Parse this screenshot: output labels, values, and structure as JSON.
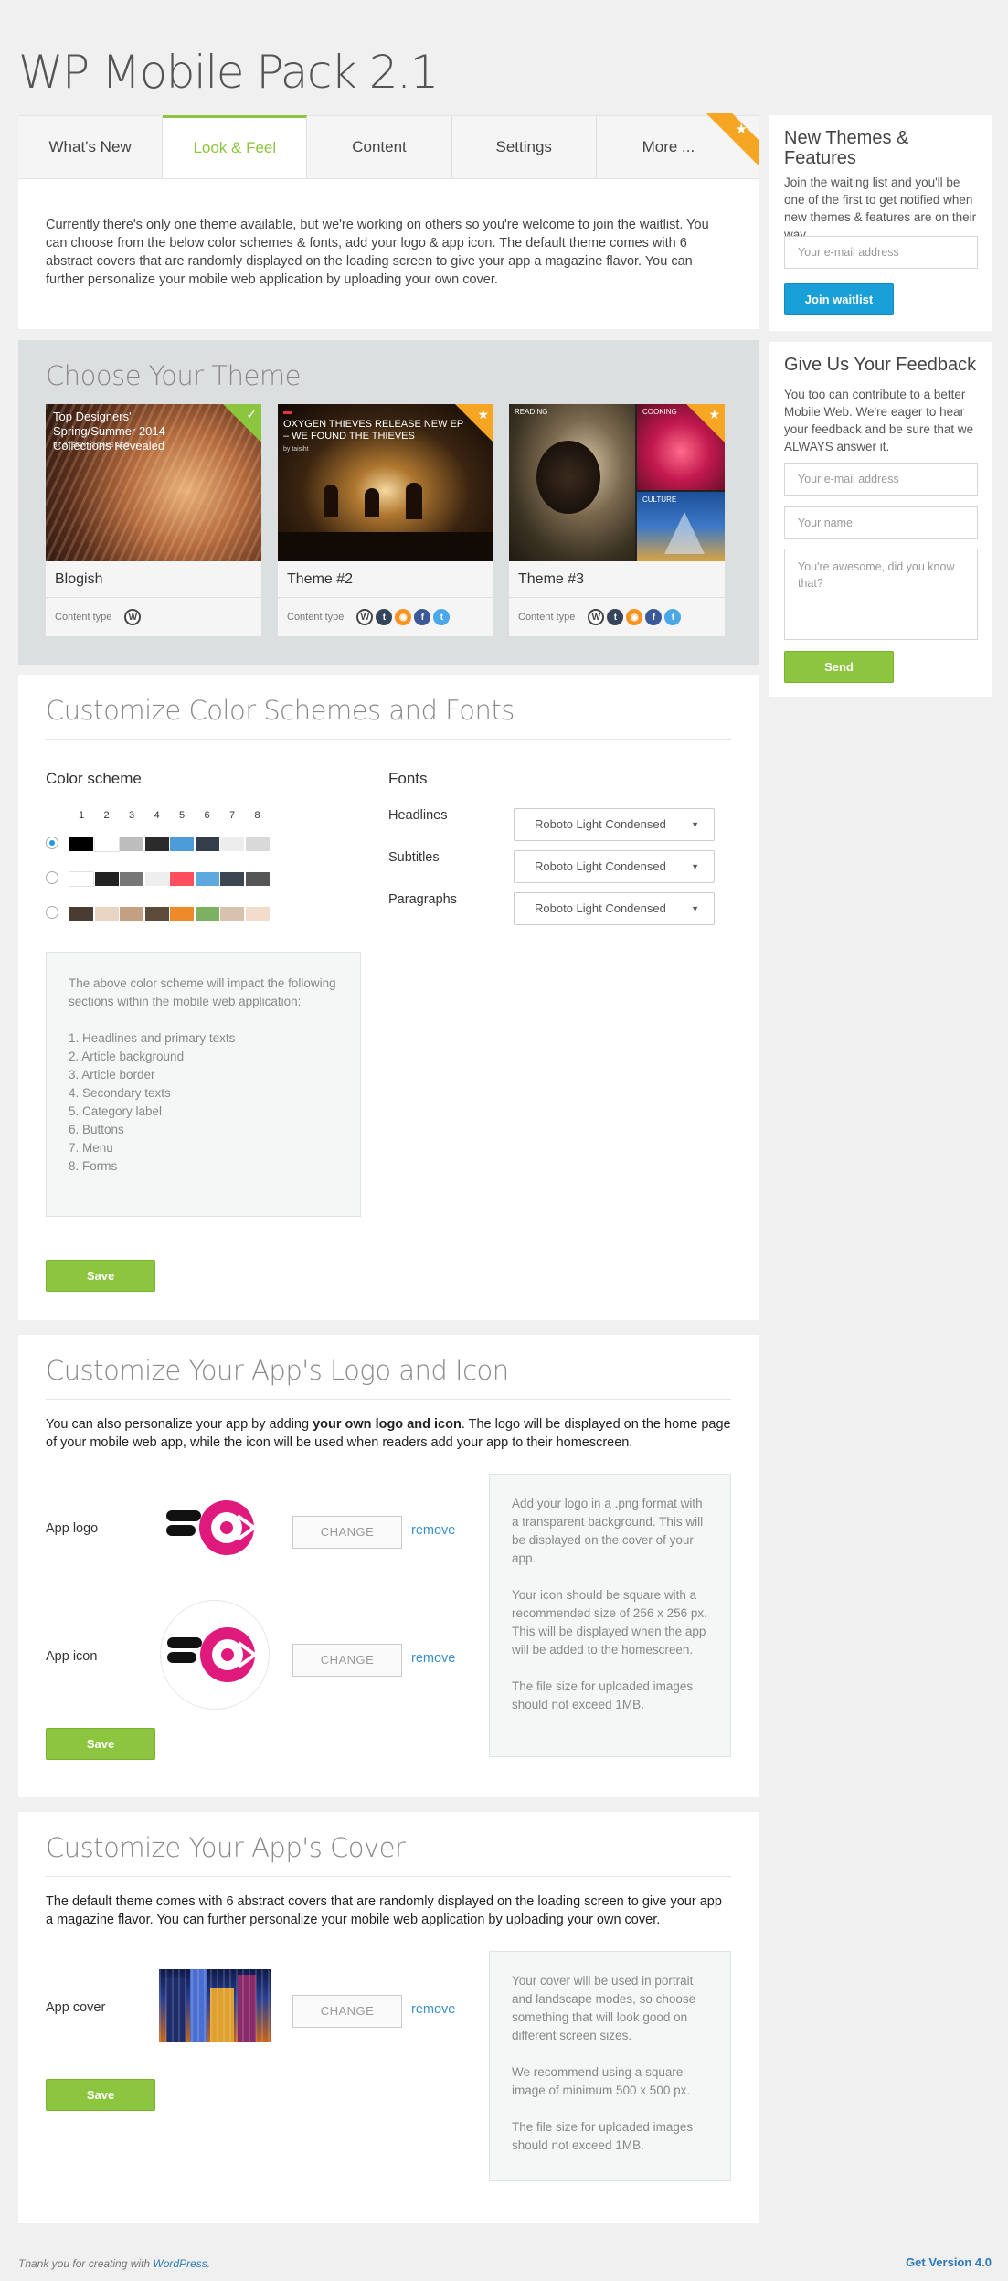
{
  "app_title": "WP Mobile Pack 2.1",
  "tabs": [
    {
      "label": "What's New"
    },
    {
      "label": "Look & Feel"
    },
    {
      "label": "Content"
    },
    {
      "label": "Settings"
    },
    {
      "label": "More ..."
    }
  ],
  "intro_text": "Currently there's only one theme available, but we're working on others so you're welcome to join the waitlist. You can choose from the below color schemes & fonts, add your logo & app icon. The default theme comes with 6 abstract covers that are randomly displayed on the loading screen to give your app a magazine flavor. You can further personalize your mobile web application by uploading your own cover.",
  "themes": {
    "title": "Choose Your Theme",
    "content_type_label": "Content type",
    "cards": [
      {
        "name": "Blogish",
        "caption": "Top Designers' Spring/Summer 2014 Collections Revealed",
        "meta": "BY STEFIN · 3 DAYS AGO",
        "icons": [
          "wordpress-icon"
        ]
      },
      {
        "name": "Theme #2",
        "caption": "OXYGEN THIEVES RELEASE NEW EP – WE FOUND THE THIEVES",
        "meta": "by taisiht",
        "icons": [
          "wordpress-icon",
          "tumblr-icon",
          "rss-icon",
          "facebook-icon",
          "twitter-icon"
        ]
      },
      {
        "name": "Theme #3",
        "tag1": "READING",
        "tag2": "COOKING",
        "tag3": "CULTURE",
        "icons": [
          "wordpress-icon",
          "tumblr-icon",
          "rss-icon",
          "facebook-icon",
          "twitter-icon"
        ]
      }
    ]
  },
  "colors_section": {
    "title": "Customize Color Schemes and Fonts",
    "scheme_label": "Color scheme",
    "numbers": [
      "1",
      "2",
      "3",
      "4",
      "5",
      "6",
      "7",
      "8"
    ],
    "schemes": [
      [
        "#000000",
        "#ffffff",
        "#bdbdbd",
        "#2b2b2b",
        "#4d9bd8",
        "#333e4a",
        "#ededed",
        "#d9d9d9"
      ],
      [
        "#ffffff",
        "#222222",
        "#777777",
        "#eeeeee",
        "#ff4f5e",
        "#5ea8e0",
        "#3c4650",
        "#555555"
      ],
      [
        "#4a3c30",
        "#e9d6c2",
        "#c4a083",
        "#5c4a3a",
        "#ef8a2a",
        "#7eb062",
        "#d6c2ae",
        "#f2dccb"
      ]
    ],
    "fonts_label": "Fonts",
    "font_rows": [
      {
        "label": "Headlines",
        "value": "Roboto Light Condensed"
      },
      {
        "label": "Subtitles",
        "value": "Roboto Light Condensed"
      },
      {
        "label": "Paragraphs",
        "value": "Roboto Light Condensed"
      }
    ],
    "info_intro": "The above color scheme will impact the following sections within the mobile web application:",
    "info_items": [
      "1. Headlines and primary texts",
      "2. Article background",
      "3. Article border",
      "4. Secondary texts",
      "5. Category label",
      "6. Buttons",
      "7. Menu",
      "8. Forms"
    ],
    "save_label": "Save"
  },
  "logo_section": {
    "title": "Customize Your App's Logo and Icon",
    "text_pre": "You can also personalize your app by adding ",
    "text_bold": "your own logo and icon",
    "text_post": ". The logo will be displayed on the home page of your mobile web app, while the icon will be used when readers add your app to their homescreen.",
    "logo_label": "App logo",
    "icon_label": "App icon",
    "change_label": "CHANGE",
    "remove_label": "remove",
    "info1": "Add your logo in a .png format with a transparent background. This will be displayed on the cover of your app.",
    "info2": "Your icon should be square with a recommended size of 256 x 256 px. This will be displayed when the app will be added to the homescreen.",
    "info3": "The file size for uploaded images should not exceed 1MB.",
    "save_label": "Save"
  },
  "cover_section": {
    "title": "Customize Your App's Cover",
    "text": "The default theme comes with 6 abstract covers that are randomly displayed on the loading screen to give your app a magazine flavor. You can further personalize your mobile web application by uploading your own cover.",
    "cover_label": "App cover",
    "change_label": "CHANGE",
    "remove_label": "remove",
    "info1": "Your cover will be used in portrait and landscape modes, so choose something that will look good on different screen sizes.",
    "info2": "We recommend using a square image of minimum 500 x 500 px.",
    "info3": "The file size for uploaded images should not exceed 1MB.",
    "save_label": "Save"
  },
  "sidebar": {
    "new_themes": {
      "title": "New Themes & Features",
      "text": "Join the waiting list and you'll be one of the first to get notified when new themes & features are on their way.",
      "email_placeholder": "Your e-mail address",
      "button_label": "Join waitlist"
    },
    "feedback": {
      "title": "Give Us Your Feedback",
      "text": "You too can contribute to a better Mobile Web. We're eager to hear your feedback and be sure that we ALWAYS answer it.",
      "email_placeholder": "Your e-mail address",
      "name_placeholder": "Your name",
      "message_placeholder": "You're awesome, did you know that?",
      "button_label": "Send"
    }
  },
  "footer": {
    "left_pre": "Thank you for creating with ",
    "left_link": "WordPress",
    "left_post": ".",
    "right": "Get Version 4.0"
  },
  "accent_colors": {
    "green": "#8cc63f",
    "blue": "#1aa0d8",
    "orange": "#f6a623",
    "pink": "#e0197d"
  }
}
